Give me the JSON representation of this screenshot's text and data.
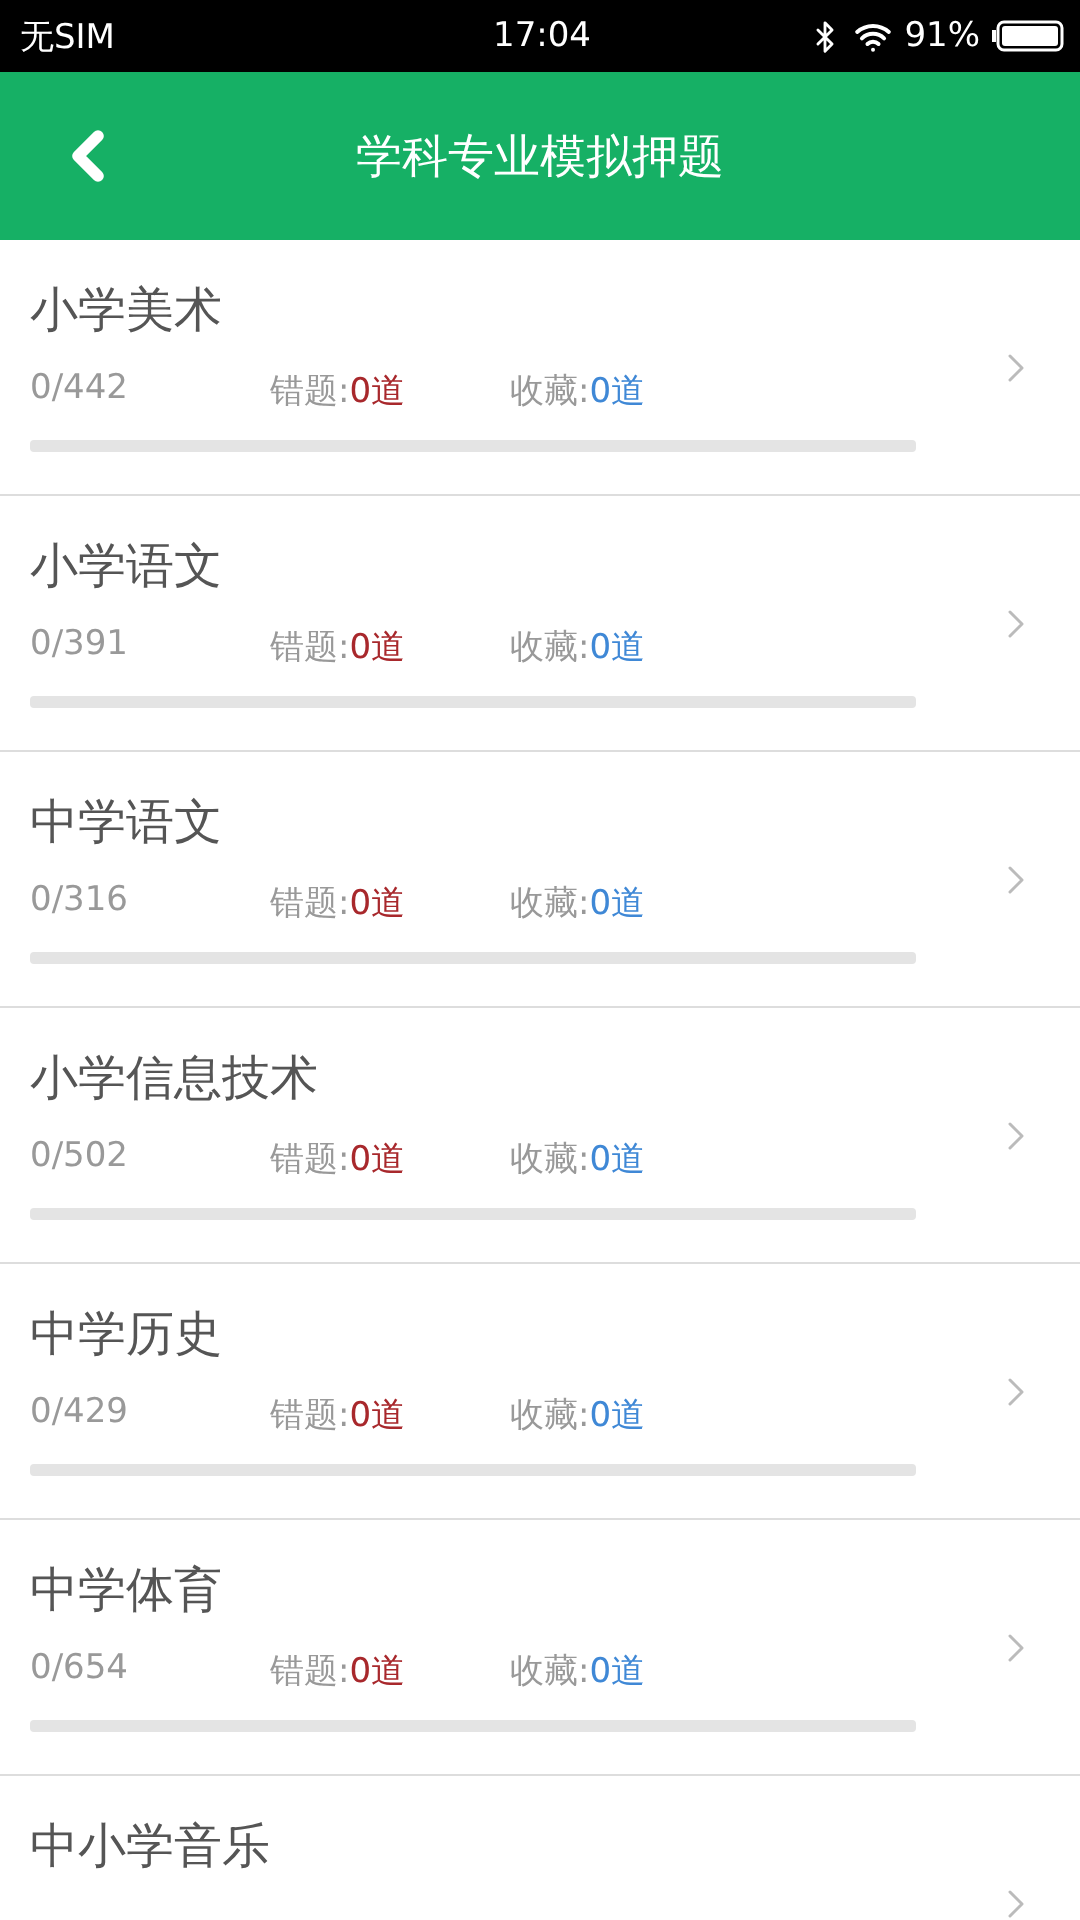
{
  "status_bar": {
    "carrier": "无SIM",
    "time": "17:04",
    "battery": "91%"
  },
  "header": {
    "title": "学科专业模拟押题"
  },
  "subjects": [
    {
      "name": "小学美术",
      "progress": "0/442",
      "wrong_label": "错题:",
      "wrong_count": "0道",
      "fav_label": "收藏:",
      "fav_count": "0道",
      "level": 0
    },
    {
      "name": "小学语文",
      "progress": "0/391",
      "wrong_label": "错题:",
      "wrong_count": "0道",
      "fav_label": "收藏:",
      "fav_count": "0道",
      "level": 0
    },
    {
      "name": "中学语文",
      "progress": "0/316",
      "wrong_label": "错题:",
      "wrong_count": "0道",
      "fav_label": "收藏:",
      "fav_count": "0道",
      "level": 0
    },
    {
      "name": "小学信息技术",
      "progress": "0/502",
      "wrong_label": "错题:",
      "wrong_count": "0道",
      "fav_label": "收藏:",
      "fav_count": "0道",
      "level": 0
    },
    {
      "name": "中学历史",
      "progress": "0/429",
      "wrong_label": "错题:",
      "wrong_count": "0道",
      "fav_label": "收藏:",
      "fav_count": "0道",
      "level": 0
    },
    {
      "name": "中学体育",
      "progress": "0/654",
      "wrong_label": "错题:",
      "wrong_count": "0道",
      "fav_label": "收藏:",
      "fav_count": "0道",
      "level": 0
    },
    {
      "name": "中小学音乐"
    }
  ]
}
